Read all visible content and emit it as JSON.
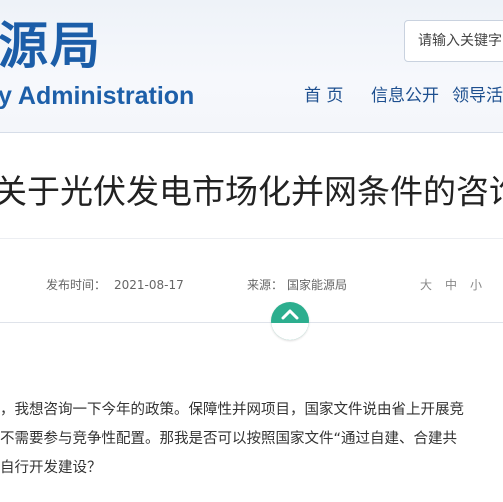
{
  "header": {
    "logo_cn": "源局",
    "logo_en": "y Administration",
    "search_placeholder": "请输入关键字",
    "nav": [
      "首 页",
      "信息公开",
      "领导活"
    ]
  },
  "article": {
    "title": "关于光伏发电市场化并网条件的咨询",
    "publish_label": "发布时间：",
    "publish_date": "2021-08-17",
    "source_label": "来源：",
    "source": "国家能源局",
    "font_sizes": [
      "大",
      "中",
      "小"
    ],
    "body_lines": [
      "，我想咨询一下今年的政策。保障性并网项目，国家文件说由省上开展竞",
      "不需要参与竞争性配置。那我是否可以按照国家文件“通过自建、合建共",
      "自行开发建设？"
    ]
  },
  "colors": {
    "brand_blue": "#1b5da8",
    "accent_green": "#2cae8e"
  },
  "icons": [
    "chevron-up-icon"
  ]
}
